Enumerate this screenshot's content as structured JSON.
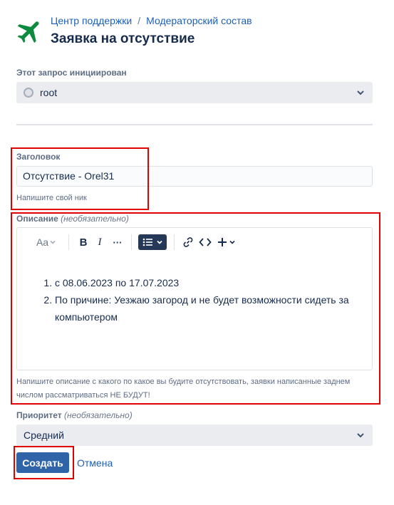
{
  "header": {
    "breadcrumb": [
      "Центр поддержки",
      "Модераторский состав"
    ],
    "breadcrumb_sep": "/",
    "title": "Заявка на отсутствие",
    "icon": "airplane-icon",
    "icon_color": "#0e8a3e"
  },
  "raised_by": {
    "label": "Этот запрос инициирован",
    "value": "root"
  },
  "summary": {
    "label": "Заголовок",
    "value": "Отсутствие - Orel31",
    "helper": "Напишите свой ник"
  },
  "description": {
    "label": "Описание",
    "optional": "(необязательно)",
    "toolbar": {
      "text_style": "Aa",
      "bold": "B",
      "italic": "I",
      "more": "···"
    },
    "items": [
      "с 08.06.2023 по 17.07.2023",
      "По причине: Уезжаю загород и не будет возможности сидеть за компьютером"
    ],
    "helper": "Напишите описание с какого по какое вы будите отсутствовать, заявки написанные заднем числом рассматриваться НЕ БУДУТ!"
  },
  "priority": {
    "label": "Приоритет",
    "optional": "(необязательно)",
    "value": "Средний"
  },
  "actions": {
    "create": "Создать",
    "cancel": "Отмена"
  },
  "colors": {
    "accent": "#2f65a8",
    "link": "#1d5fb8",
    "highlight": "#e00000"
  }
}
